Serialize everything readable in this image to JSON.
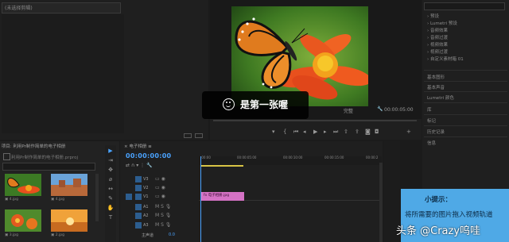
{
  "source": {
    "tab_label": "(未选择剪辑)"
  },
  "program": {
    "fit_label": "完整",
    "timecode": "00:00:05:00",
    "controls": [
      "mark-in",
      "mark-out",
      "step-back",
      "play",
      "step-forward",
      "lift",
      "extract",
      "export-frame",
      "settings"
    ]
  },
  "caption": {
    "text": "是第一张喔"
  },
  "right_panel": {
    "items": [
      "预设",
      "Lumetri 预设",
      "音频效果",
      "音频过渡",
      "视频效果",
      "视频过渡",
      "自定义素材箱 01"
    ],
    "sections": [
      "基本图形",
      "基本声音",
      "Lumetri 颜色",
      "库",
      "标记",
      "历史记录",
      "信息"
    ]
  },
  "project": {
    "title": "项目: 利用Pr制作简单的电子相册",
    "file": "利用Pr制作简单的电子相册.prproj",
    "thumbs": [
      {
        "label": "4.jpg",
        "scene": "butterfly"
      },
      {
        "label": "4.jpg",
        "scene": "desert"
      },
      {
        "label": "3.jpg",
        "scene": "flower"
      },
      {
        "label": "2.jpg",
        "scene": "sunset"
      }
    ]
  },
  "timeline": {
    "title": "电子相册",
    "timecode": "00:00:00:00",
    "ruler_ticks": [
      ":00:00",
      "00:00:05:00",
      "00:00:10:00",
      "00:00:15:00",
      "00:00:2"
    ],
    "video_tracks": [
      "V3",
      "V2",
      "V1"
    ],
    "audio_tracks": [
      "A1",
      "A2",
      "A3"
    ],
    "master_label": "主声道",
    "master_value": "0.0",
    "clip_label": "电子相册.jpg"
  },
  "tip": {
    "title": "小提示：",
    "body": "将所需要的图片拖入视频轨道"
  },
  "watermark": {
    "text": "头条 @Crazy呜哇"
  }
}
